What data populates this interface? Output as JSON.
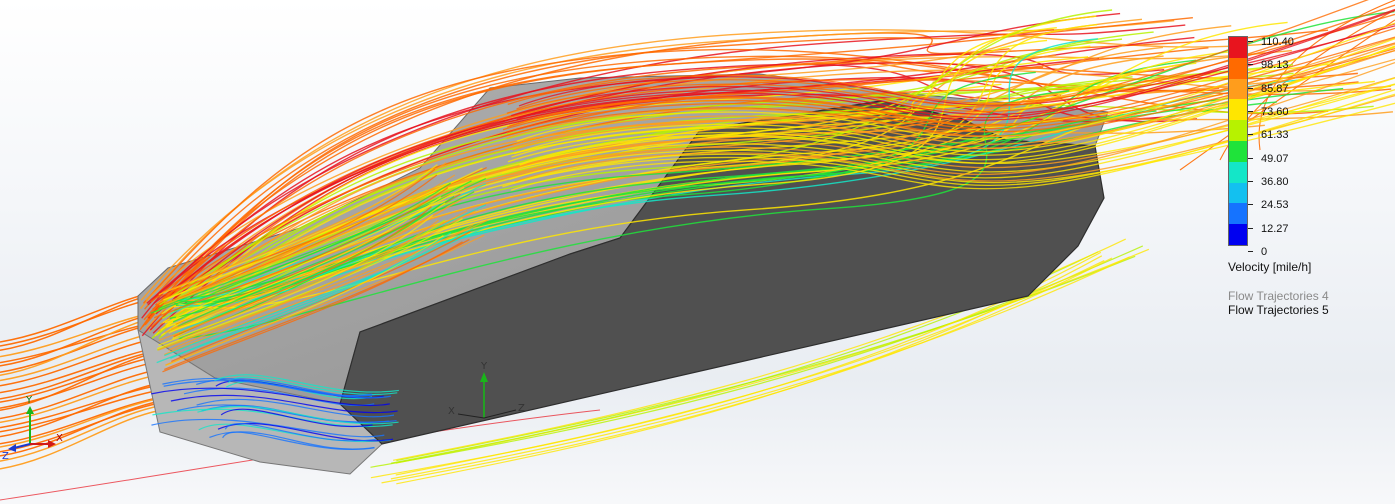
{
  "legend": {
    "title": "Velocity [mile/h]",
    "labels": [
      "110.40",
      "98.13",
      "85.87",
      "73.60",
      "61.33",
      "49.07",
      "36.80",
      "24.53",
      "12.27",
      "0"
    ],
    "colors": [
      "#e8141e",
      "#ff6a00",
      "#ff9d1c",
      "#ffe600",
      "#b7f200",
      "#1fe33a",
      "#14e6c8",
      "#13c0f0",
      "#1573ff",
      "#0000f0"
    ],
    "max": 110.4,
    "min": 0
  },
  "trajectories": {
    "items": [
      {
        "label": "Flow Trajectories 4",
        "active": false
      },
      {
        "label": "Flow Trajectories 5",
        "active": true
      }
    ]
  },
  "triads": {
    "small": {
      "x": "X",
      "y": "Y",
      "z": "Z"
    },
    "main": {
      "x": "X",
      "y": "Y",
      "z": "Z"
    }
  },
  "model": {
    "body_color": "#505050",
    "top_color": "#9c9c9c"
  }
}
